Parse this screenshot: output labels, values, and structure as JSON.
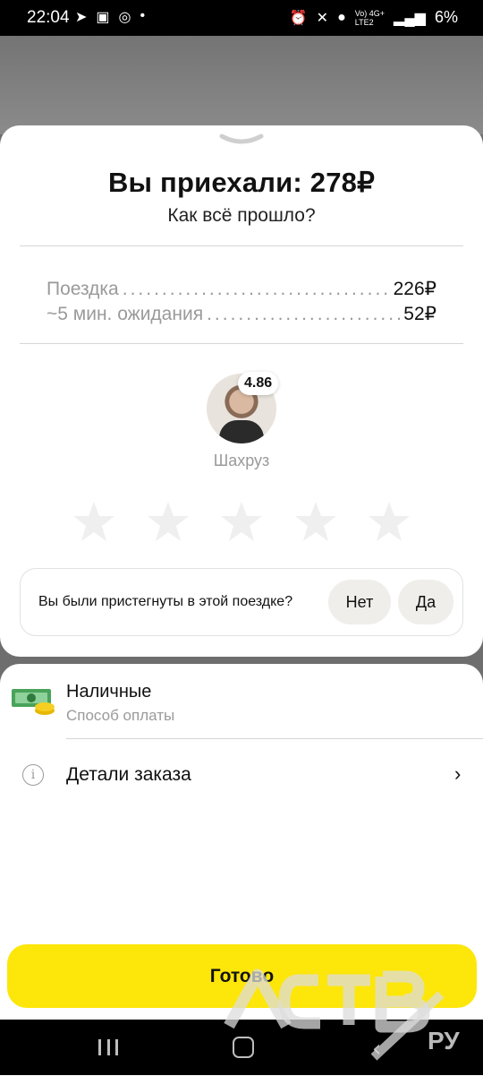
{
  "status_bar": {
    "time": "22:04",
    "left_icons": [
      "telegram-icon",
      "gallery-icon",
      "sync-icon",
      "dot"
    ],
    "right_icons": [
      "alarm-icon",
      "mute-icon",
      "location-icon",
      "volte-icon",
      "signal-icon"
    ],
    "battery": "6%"
  },
  "sheet": {
    "title": "Вы приехали: 278₽",
    "subtitle": "Как всё прошло?",
    "lines": [
      {
        "label": "Поездка",
        "value": "226₽"
      },
      {
        "label": "~5 мин. ожидания",
        "value": "52₽"
      }
    ]
  },
  "driver": {
    "name": "Шахруз",
    "rating": "4.86",
    "stars_count": 5,
    "stars_selected": 0
  },
  "seatbelt": {
    "question": "Вы были пристегнуты в этой поездке?",
    "no_label": "Нет",
    "yes_label": "Да"
  },
  "payment": {
    "method": "Наличные",
    "caption": "Способ оплаты",
    "icon": "cash-icon"
  },
  "details": {
    "label": "Детали заказа",
    "icon": "info-icon"
  },
  "done_button": {
    "label": "Готово",
    "color": "#fde60a"
  },
  "watermark": {
    "text": "АСТВ",
    "suffix": "РУ"
  },
  "nav_bar": {
    "buttons": [
      "recents-icon",
      "home-icon",
      "back-icon"
    ]
  }
}
